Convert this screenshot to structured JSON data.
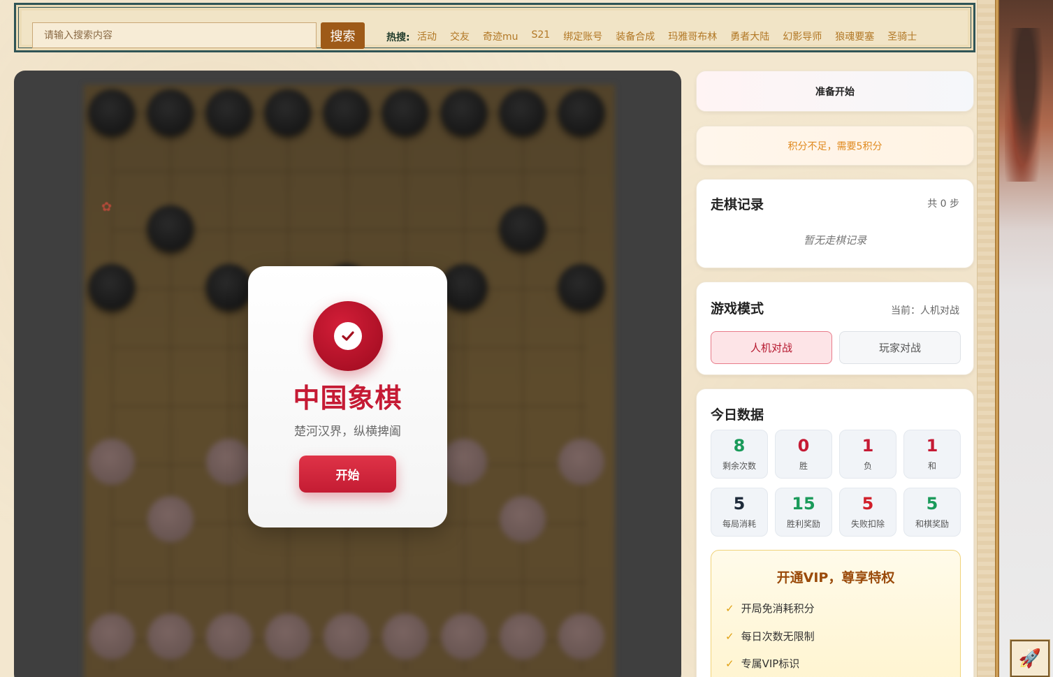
{
  "search": {
    "placeholder": "请输入搜索内容",
    "button_label": "搜索",
    "hot_label": "热搜:",
    "hot_links": [
      "活动",
      "交友",
      "奇迹mu",
      "S21",
      "绑定账号",
      "装备合成",
      "玛雅哥布林",
      "勇者大陆",
      "幻影导师",
      "狼魂要塞",
      "圣骑士"
    ]
  },
  "dialog": {
    "title": "中国象棋",
    "subtitle": "楚河汉界，纵横捭阖",
    "start_label": "开始",
    "icon": "check-circle-icon"
  },
  "status": {
    "state_text": "准备开始",
    "points_warning": "积分不足，需要5积分"
  },
  "moves": {
    "title": "走棋记录",
    "count_text": "共 0 步",
    "empty_text": "暂无走棋记录"
  },
  "mode": {
    "title": "游戏模式",
    "current_text": "当前：人机对战",
    "options": [
      "人机对战",
      "玩家对战"
    ],
    "selected": "人机对战"
  },
  "stats": {
    "title": "今日数据",
    "tiles": [
      {
        "value": "8",
        "label": "剩余次数",
        "color": "#1a9a5a"
      },
      {
        "value": "0",
        "label": "胜",
        "color": "#c51a34"
      },
      {
        "value": "1",
        "label": "负",
        "color": "#c51a34"
      },
      {
        "value": "1",
        "label": "和",
        "color": "#c51a34"
      },
      {
        "value": "5",
        "label": "每局消耗",
        "color": "#1d2a3a"
      },
      {
        "value": "15",
        "label": "胜利奖励",
        "color": "#1a9a5a"
      },
      {
        "value": "5",
        "label": "失败扣除",
        "color": "#d11f2a"
      },
      {
        "value": "5",
        "label": "和棋奖励",
        "color": "#1a9a5a"
      }
    ]
  },
  "vip": {
    "title": "开通VIP，尊享特权",
    "items": [
      "开局免消耗积分",
      "每日次数无限制",
      "专属VIP标识"
    ]
  },
  "colors": {
    "accent_red": "#c51a34",
    "search_button": "#9e5a18",
    "hot_link": "#b27826",
    "topbar_border": "#2f5456"
  },
  "widgets": {
    "back_to_top": "rocket-icon"
  }
}
